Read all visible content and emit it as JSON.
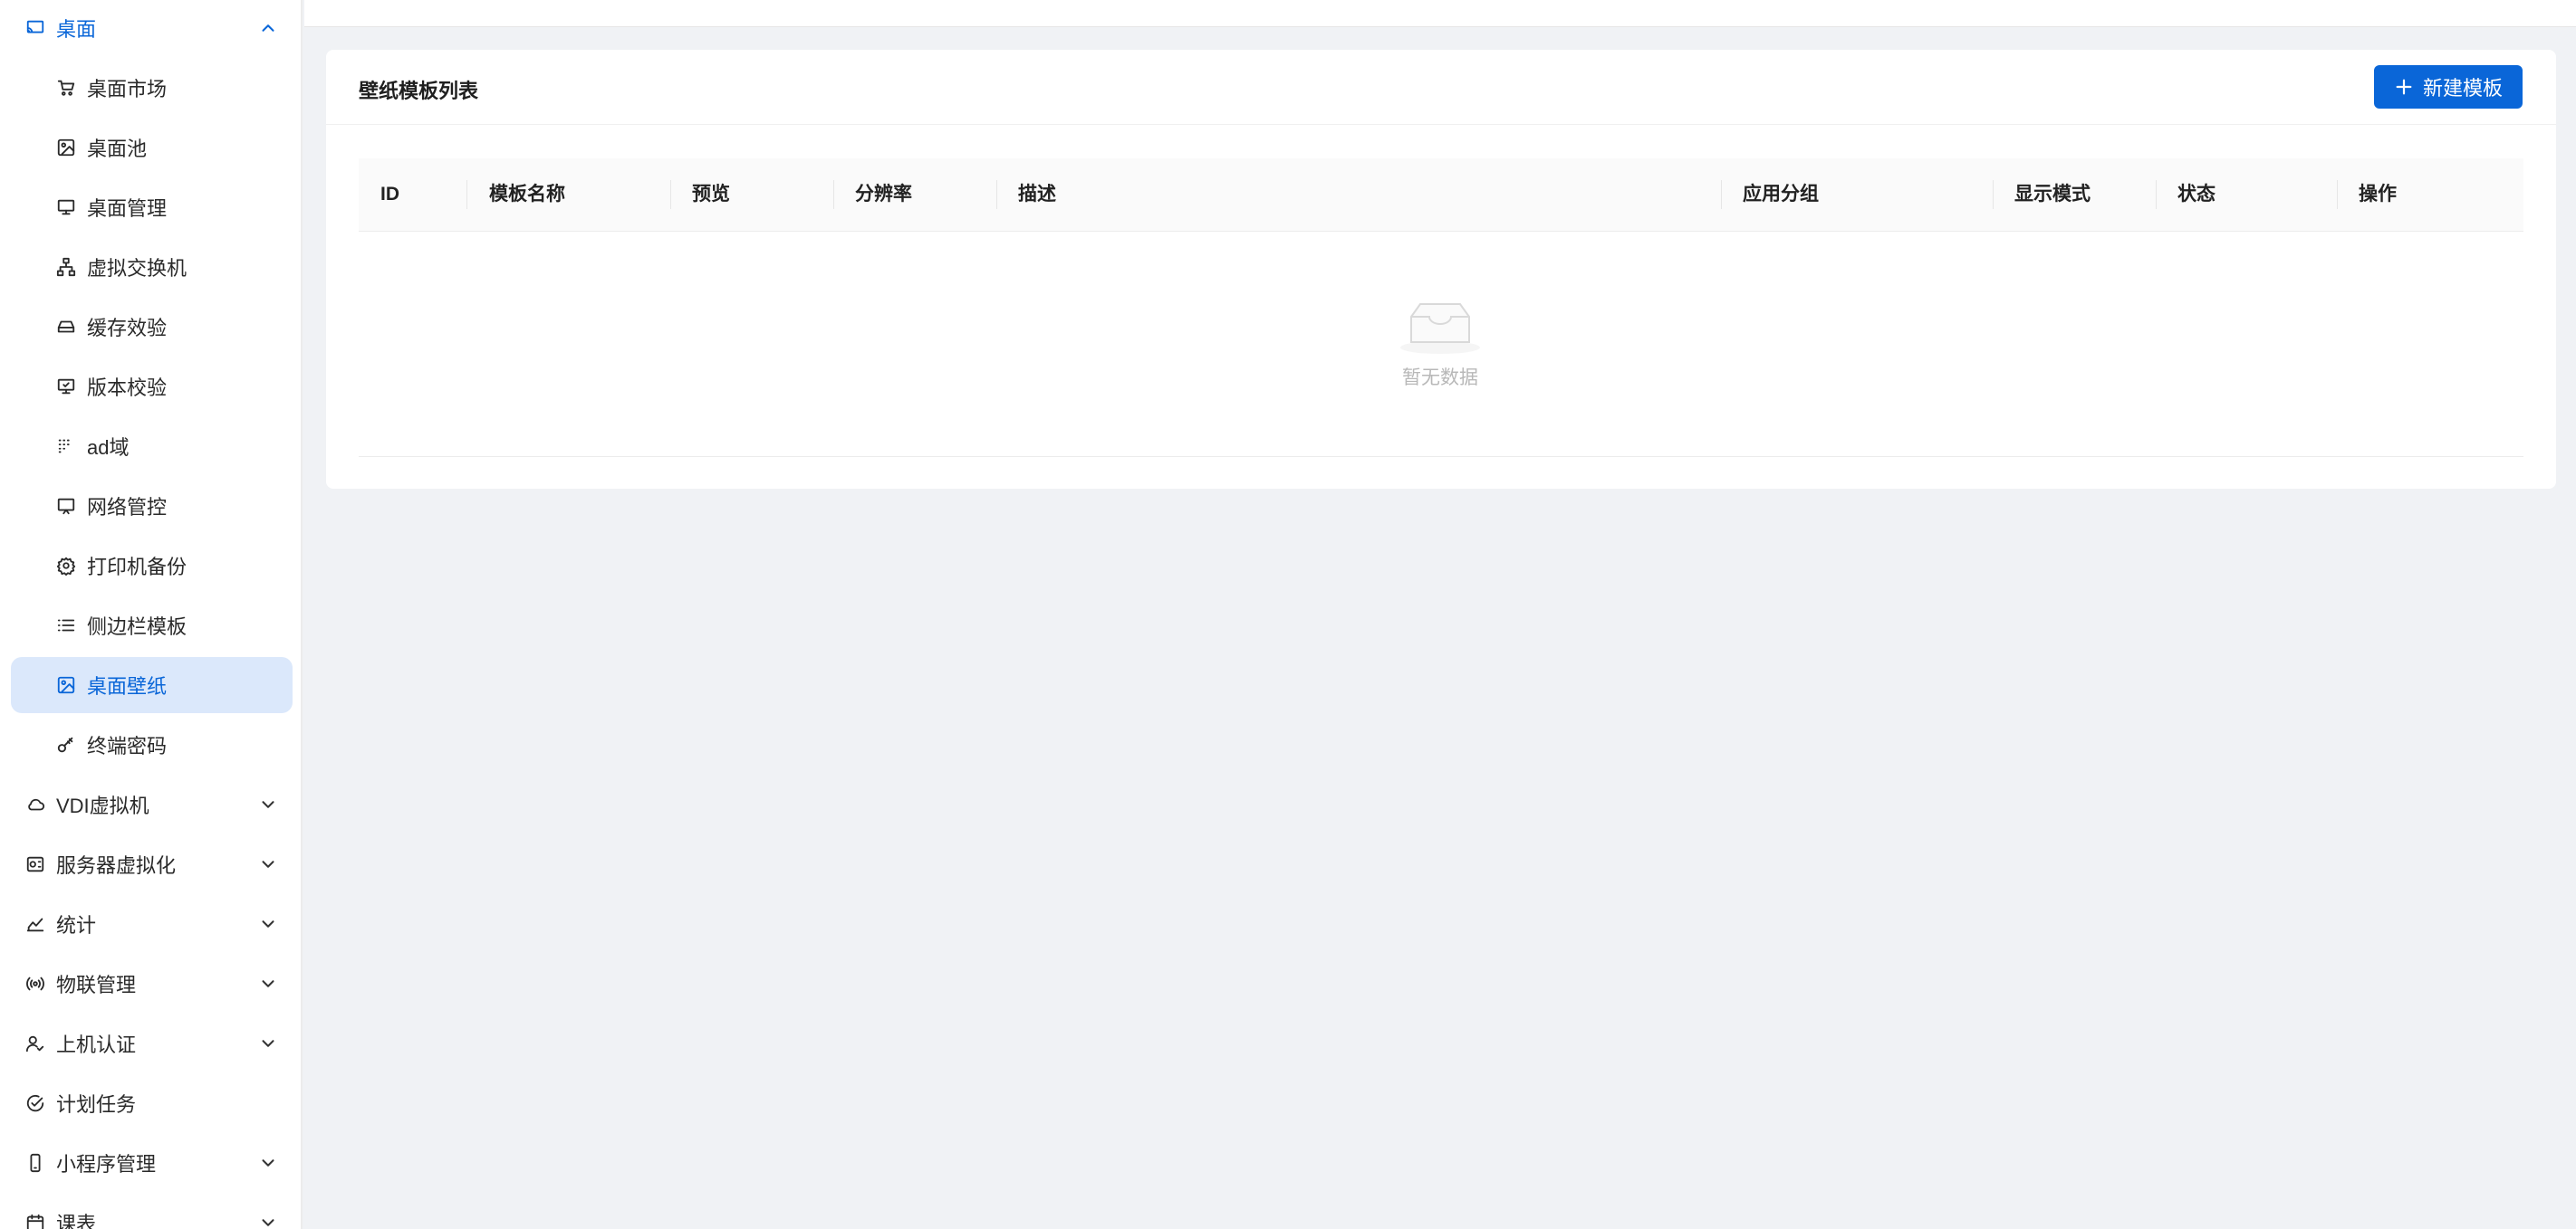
{
  "sidebar": {
    "items": [
      {
        "label": "桌面",
        "icon": "desktop-cast-icon",
        "type": "top",
        "open": true
      },
      {
        "label": "桌面市场",
        "icon": "cart-icon",
        "type": "sub"
      },
      {
        "label": "桌面池",
        "icon": "image-icon",
        "type": "sub"
      },
      {
        "label": "桌面管理",
        "icon": "monitor-icon",
        "type": "sub"
      },
      {
        "label": "虚拟交换机",
        "icon": "network-icon",
        "type": "sub"
      },
      {
        "label": "缓存效验",
        "icon": "drive-icon",
        "type": "sub"
      },
      {
        "label": "版本校验",
        "icon": "monitor-check-icon",
        "type": "sub"
      },
      {
        "label": "ad域",
        "icon": "grid-dots-icon",
        "type": "sub"
      },
      {
        "label": "网络管控",
        "icon": "screen-icon",
        "type": "sub"
      },
      {
        "label": "打印机备份",
        "icon": "gear-icon",
        "type": "sub"
      },
      {
        "label": "侧边栏模板",
        "icon": "list-icon",
        "type": "sub"
      },
      {
        "label": "桌面壁纸",
        "icon": "image-icon",
        "type": "sub",
        "active": true
      },
      {
        "label": "终端密码",
        "icon": "key-icon",
        "type": "sub"
      },
      {
        "label": "VDI虚拟机",
        "icon": "cloud-icon",
        "type": "top",
        "chevron": true
      },
      {
        "label": "服务器虚拟化",
        "icon": "server-icon",
        "type": "top",
        "chevron": true
      },
      {
        "label": "统计",
        "icon": "chart-icon",
        "type": "top",
        "chevron": true
      },
      {
        "label": "物联管理",
        "icon": "broadcast-icon",
        "type": "top",
        "chevron": true
      },
      {
        "label": "上机认证",
        "icon": "user-check-icon",
        "type": "top",
        "chevron": true
      },
      {
        "label": "计划任务",
        "icon": "check-circle-icon",
        "type": "top"
      },
      {
        "label": "小程序管理",
        "icon": "phone-icon",
        "type": "top",
        "chevron": true
      },
      {
        "label": "课表",
        "icon": "calendar-icon",
        "type": "top",
        "chevron": true
      }
    ]
  },
  "card": {
    "title": "壁纸模板列表",
    "new_button": "新建模板"
  },
  "table": {
    "columns": [
      "ID",
      "模板名称",
      "预览",
      "分辨率",
      "描述",
      "应用分组",
      "显示模式",
      "状态",
      "操作"
    ],
    "rows": [],
    "empty_text": "暂无数据"
  },
  "colors": {
    "accent": "#0a66d8",
    "active_bg": "#dbe8fb",
    "page_bg": "#f0f2f5"
  }
}
